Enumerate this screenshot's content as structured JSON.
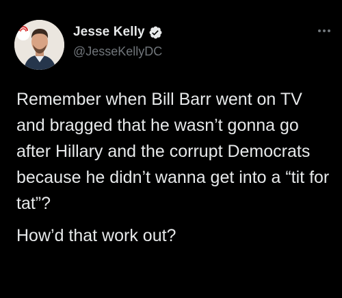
{
  "author": {
    "display_name": "Jesse Kelly",
    "handle": "@JesseKellyDC",
    "verified": true,
    "avatar_badge": "FIRST"
  },
  "icons": {
    "verified": "verified-badge-icon",
    "more": "more-options-icon"
  },
  "tweet": {
    "paragraph_1": "Remember when Bill Barr went on TV and bragged that he wasn’t gonna go after Hillary and the corrupt Democrats because he didn’t wanna get into a “tit for tat”?",
    "paragraph_2": "How’d that work out?"
  },
  "colors": {
    "background": "#000000",
    "text": "#e7e9ea",
    "secondary_text": "#71767b",
    "verified": "#e7e9ea"
  }
}
